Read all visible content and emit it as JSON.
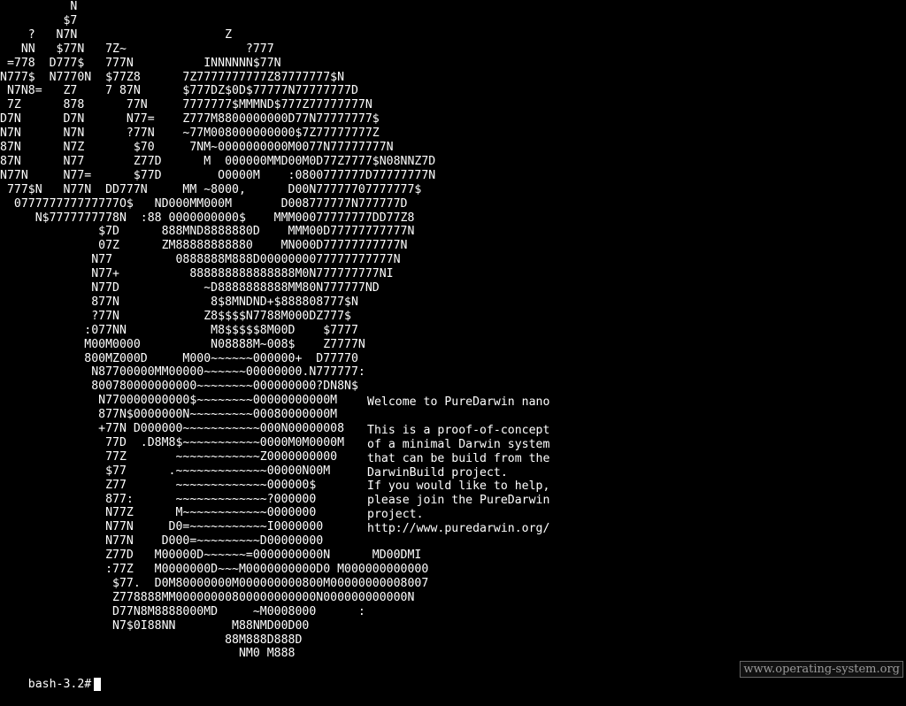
{
  "terminal": {
    "background": "#000000",
    "foreground": "#ffffff",
    "art_lines": [
      "          N",
      "         $7",
      "    ?   N7N                     Z",
      "   NN   $77N   7Z~                 ?777",
      " =778  D777$   777N          INNNNNN$77N",
      "N777$  N7770N  $77Z8      7Z7777777777Z87777777$N",
      " N7N8=   Z7    7 87N      $777DZ$0D$77777N77777777D",
      " 7Z      878      77N     7777777$MMMND$777Z77777777N",
      "D7N      D7N      N77=    Z777M8800000000D77N77777777$",
      "N7N      N7N      ?77N    ~77M008000000000$7Z77777777Z",
      "87N      N7Z       $70     7NM~0000000000M0077N77777777N",
      "87N      N77       Z77D      M  000000MMD00M0D77Z7777$N08NNZ7D",
      "N77N     N77=      $77D        O0000M    :0800777777D77777777N",
      " 777$N   N77N  DD777N     MM ~8000,      D00N77777707777777$",
      "  077777777777777O$   ND000MM000M       D008777777N777777D",
      "     N$7777777778N  :88 0000000000$    MMM00077777777DD77Z8",
      "              $7D      888MND8888880D    MMM00D77777777777N",
      "              07Z      ZM88888888880    MN000D77777777777N",
      "             N77         0888888M888D0000000077777777777N",
      "             N77+          888888888888888M0N777777777NI",
      "             N77D            ~D8888888888MM80N777777ND",
      "             877N             8$8MNDND+$888808777$N",
      "             ?77N            Z8$$$$N7788M000DZ777$",
      "            :077NN            M8$$$$$8M00D    $7777",
      "            M00M0000          N08888M~008$    Z7777N",
      "            800MZ000D     M000~~~~~~000000+  D77770",
      "             N87700000MM00000~~~~~~00000000.N777777:",
      "             800780000000000~~~~~~~~000000000?DN8N$",
      "              N770000000000$~~~~~~~~00000000000M",
      "              877N$0000000N~~~~~~~~~00080000000M",
      "              +77N D000000~~~~~~~~~~~000N00000008",
      "               77D  .D8M8$~~~~~~~~~~~0000M0M0000M",
      "               77Z       ~~~~~~~~~~~~Z0000000000",
      "               $77      .~~~~~~~~~~~~~00000N00M",
      "               Z77       ~~~~~~~~~~~~~000000$",
      "               877:      ~~~~~~~~~~~~~?000000",
      "               N77Z      M~~~~~~~~~~~~0000000",
      "               N77N     D0=~~~~~~~~~~~I0000000",
      "               N77N    D000=~~~~~~~~~D00000000",
      "               Z77D   M00000D~~~~~~=0000000000N      MD00DMI",
      "               :77Z   M0000000D~~~M0000000000D0 M000000000000",
      "                $77.  D0M80000000M000000000800M00000000008007",
      "                Z778888MM00000000800000000000N000000000000N",
      "                D77N8M8888000MD     ~M0008000      :",
      "                N7$0I88NN        M88NMD00D00",
      "                                88M888D888D",
      "                                  NM0 M888"
    ],
    "welcome_lines": [
      "Welcome to PureDarwin nano",
      "",
      "This is a proof-of-concept",
      "of a minimal Darwin system",
      "that can be build from the",
      "DarwinBuild project.",
      "If you would like to help,",
      "please join the PureDarwin",
      "project.",
      "http://www.puredarwin.org/"
    ],
    "prompt": "bash-3.2#"
  },
  "watermark": {
    "text": "www.operating-system.org"
  }
}
